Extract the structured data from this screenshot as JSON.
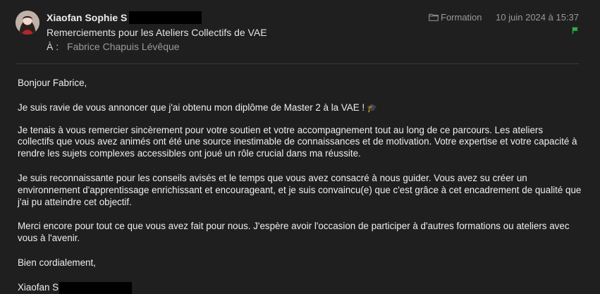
{
  "header": {
    "sender_name": "Xiaofan Sophie S",
    "subject": "Remerciements pour les Ateliers Collectifs de VAE",
    "to_label": "À :",
    "to_value": "Fabrice Chapuis Lévêque",
    "folder": "Formation",
    "date": "10 juin 2024 à 15:37",
    "icons": {
      "avatar": "avatar",
      "folder": "folder-icon",
      "flag": "flag-icon"
    },
    "colors": {
      "flag": "#2bb24c",
      "meta_text": "#9a9a9a"
    }
  },
  "body": {
    "greeting": "Bonjour Fabrice,",
    "p1": "Je suis ravie de vous annoncer que j'ai obtenu mon diplôme de Master 2 à la VAE !",
    "p1_emoji": "🎓",
    "p2": "Je tenais à vous remercier sincèrement pour votre soutien et votre accompagnement tout au long de ce parcours. Les ateliers collectifs que vous avez animés ont été une source inestimable de connaissances et de motivation. Votre expertise et votre capacité à rendre les sujets complexes accessibles ont joué un rôle crucial dans ma réussite.",
    "p3": "Je suis reconnaissante pour les conseils avisés et le temps que vous avez consacré à nous guider. Vous avez su créer un environnement d'apprentissage enrichissant et encourageant, et je suis convaincu(e) que c'est grâce à cet encadrement de qualité que j'ai pu atteindre cet objectif.",
    "p4": "Merci encore pour tout ce que vous avez fait pour nous. J'espère avoir l'occasion de participer à d'autres formations ou ateliers avec vous à l'avenir.",
    "closing": "Bien cordialement,",
    "signature": "Xiaofan S"
  }
}
